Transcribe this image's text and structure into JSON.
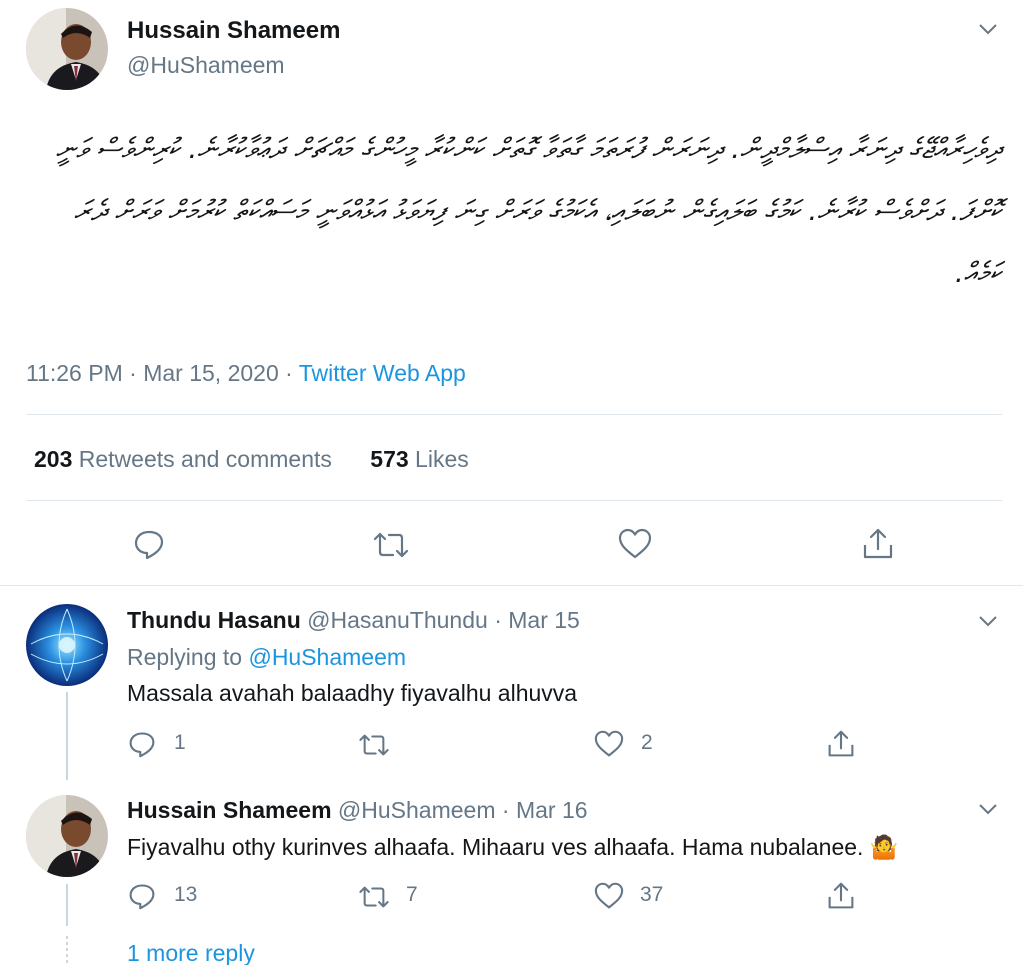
{
  "main_tweet": {
    "author_name": "Hussain Shameem",
    "author_handle": "@HuShameem",
    "text": "ދިވެހިރާއްޖޭގެ ދިނަރާ އިސްލާމްދީން. ދިނަރަން ފުރަތަމަ ގާތަވާ ގޮތަށް ކަންކުރާ މީހުންގެ މައްޗަށް ދަޢުވާކުރާނެ. ކުރިންވެސް ވަނީ ކޮށްފަ. ދަށްވެސް ކުރާނެ. ކަމުގެ ބަލައިގެން ނުބަލައި، އެކަމުގެ ވަރަށް ގިނަ ފިޔަވަޅު އަޅުއްވަނީ މަސައްކަތް ކުރުމަށް ވަރަށް ދެރަ ކަމެއް.",
    "time": "11:26 PM",
    "dot": "·",
    "date": "Mar 15, 2020",
    "source": "Twitter Web App",
    "retweets_count": "203",
    "retweets_label": "Retweets and comments",
    "likes_count": "573",
    "likes_label": "Likes"
  },
  "replies": [
    {
      "author_name": "Thundu Hasanu",
      "author_handle": "@HasanuThundu",
      "dot": "·",
      "date": "Mar 15",
      "replying_prefix": "Replying to",
      "replying_to": "@HuShameem",
      "text": "Massala avahah balaadhy fiyavalhu alhuvva",
      "reply_count": "1",
      "retweet_count": "",
      "like_count": "2"
    },
    {
      "author_name": "Hussain Shameem",
      "author_handle": "@HuShameem",
      "dot": "·",
      "date": "Mar 16",
      "text": "Fiyavalhu othy kurinves alhaafa. Mihaaru ves alhaafa. Hama nubalanee.",
      "emoji": "🤷",
      "reply_count": "13",
      "retweet_count": "7",
      "like_count": "37"
    }
  ],
  "more_replies": "1 more reply",
  "icons": {
    "reply": "reply-icon",
    "retweet": "retweet-icon",
    "like": "heart-icon",
    "share": "share-icon",
    "more": "chevron-down-icon"
  },
  "colors": {
    "accent": "#1b95e0",
    "muted": "#657786",
    "text": "#14171a",
    "divider": "#e1e8ed"
  }
}
